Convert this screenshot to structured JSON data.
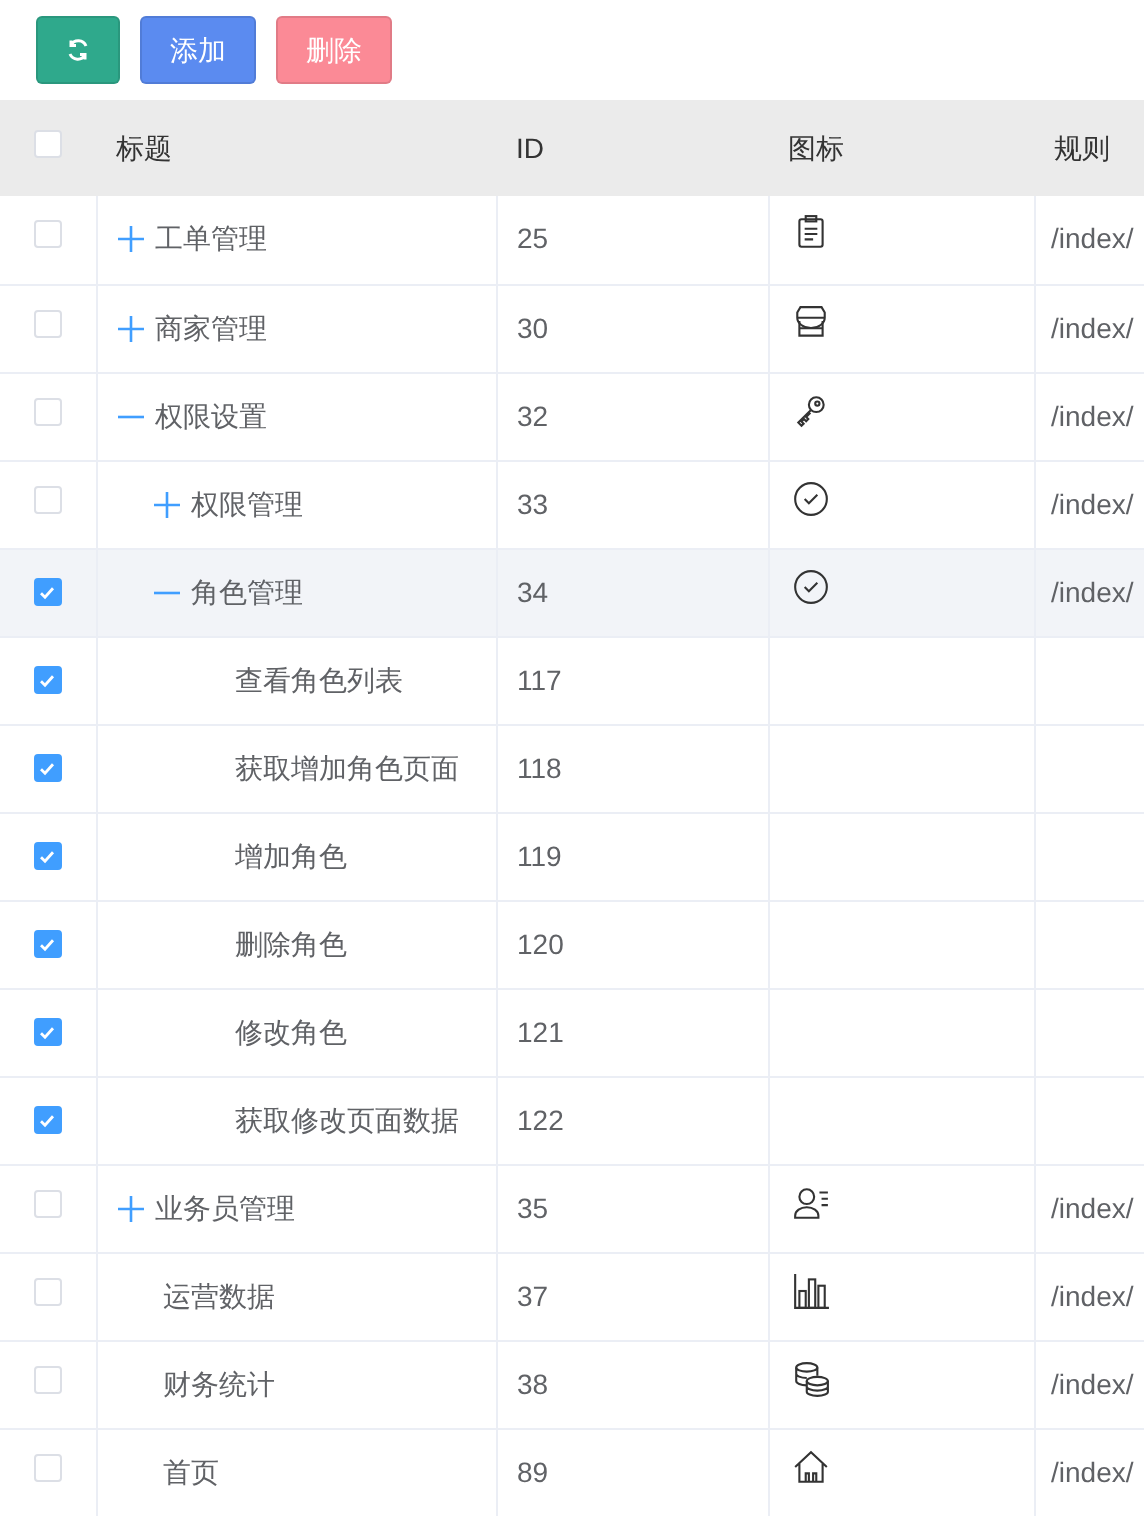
{
  "toolbar": {
    "buttons": [
      {
        "kind": "refresh"
      },
      {
        "kind": "add",
        "label": "添加"
      },
      {
        "kind": "delete",
        "label": "删除"
      }
    ]
  },
  "table": {
    "select_all": {
      "checked": false
    },
    "columns": [
      "标题",
      "ID",
      "图标",
      "规则"
    ],
    "rows": [
      {
        "title": "工单管理",
        "id": "25",
        "rule": "/index/",
        "checked": false,
        "highlighted": false,
        "expanded": false
      },
      {
        "title": "商家管理",
        "id": "30",
        "rule": "/index/",
        "checked": false,
        "highlighted": false,
        "expanded": false
      },
      {
        "title": "权限设置",
        "id": "32",
        "rule": "/index/",
        "checked": false,
        "highlighted": false,
        "expanded": true,
        "children": [
          {
            "title": "权限管理",
            "id": "33",
            "rule": "/index/",
            "checked": false,
            "highlighted": false,
            "expanded": false
          },
          {
            "title": "角色管理",
            "id": "34",
            "rule": "/index/",
            "checked": true,
            "highlighted": true,
            "expanded": true,
            "children": [
              {
                "title": "查看角色列表",
                "id": "117",
                "checked": true,
                "highlighted": false
              },
              {
                "title": "获取增加角色页面",
                "id": "118",
                "checked": true,
                "highlighted": false
              },
              {
                "title": "增加角色",
                "id": "119",
                "checked": true,
                "highlighted": false
              },
              {
                "title": "删除角色",
                "id": "120",
                "checked": true,
                "highlighted": false
              },
              {
                "title": "修改角色",
                "id": "121",
                "checked": true,
                "highlighted": false
              },
              {
                "title": "获取修改页面数据",
                "id": "122",
                "checked": true,
                "highlighted": false
              }
            ]
          }
        ]
      },
      {
        "title": "业务员管理",
        "id": "35",
        "rule": "/index/",
        "checked": false,
        "highlighted": false,
        "expanded": false
      },
      {
        "title": "运营数据",
        "id": "37",
        "rule": "/index/",
        "checked": false,
        "highlighted": false
      },
      {
        "title": "财务统计",
        "id": "38",
        "rule": "/index/",
        "checked": false,
        "highlighted": false
      },
      {
        "title": "首页",
        "id": "89",
        "rule": "/index/",
        "checked": false,
        "highlighted": false
      }
    ]
  }
}
